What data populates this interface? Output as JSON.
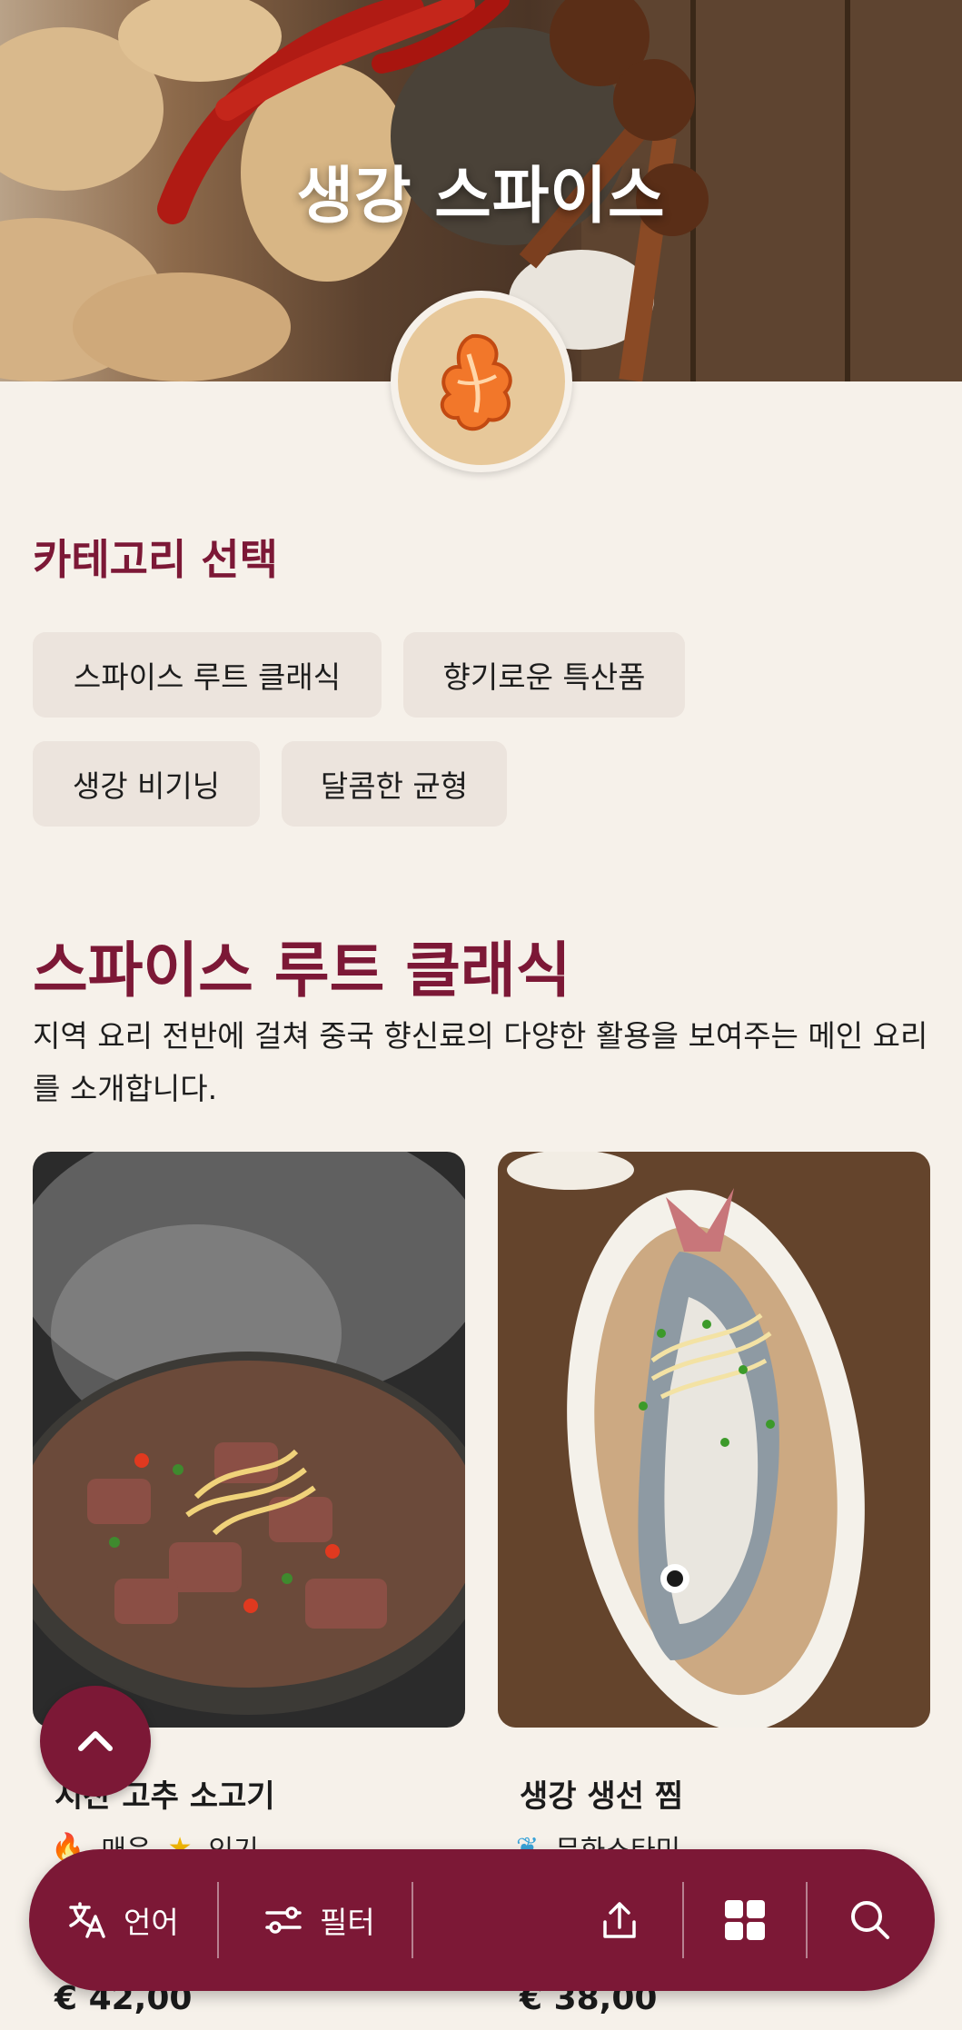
{
  "hero": {
    "title": "생강 스파이스",
    "logo_icon": "ginger-icon"
  },
  "categories": {
    "heading": "카테고리 선택",
    "chips": [
      "스파이스 루트 클래식",
      "향기로운 특산품",
      "생강 비기닝",
      "달콤한 균형"
    ]
  },
  "category": {
    "title": "스파이스 루트 클래식",
    "description": "지역 요리 전반에 걸쳐 중국 향신료의 다양한 활용을 보여주는 메인 요리를 소개합니다."
  },
  "dishes": [
    {
      "name": "시찬 고추 소고기",
      "tags": [
        "매운",
        "인기"
      ],
      "price": "€ 42,00",
      "tag_icons": [
        "flame-icon",
        "star-icon"
      ]
    },
    {
      "name": "생강 생선 찜",
      "tags": [
        "무화스타미"
      ],
      "price": "€ 38,00",
      "tag_icons": [
        "leaf-icon"
      ]
    }
  ],
  "bottom_bar": {
    "language_label": "언어",
    "filter_label": "필터",
    "icons": [
      "translate-icon",
      "filter-icon",
      "share-icon",
      "grid-icon",
      "search-icon"
    ]
  },
  "colors": {
    "accent": "#7c1836",
    "background": "#f6f1ea",
    "chip": "#ece4dd"
  }
}
